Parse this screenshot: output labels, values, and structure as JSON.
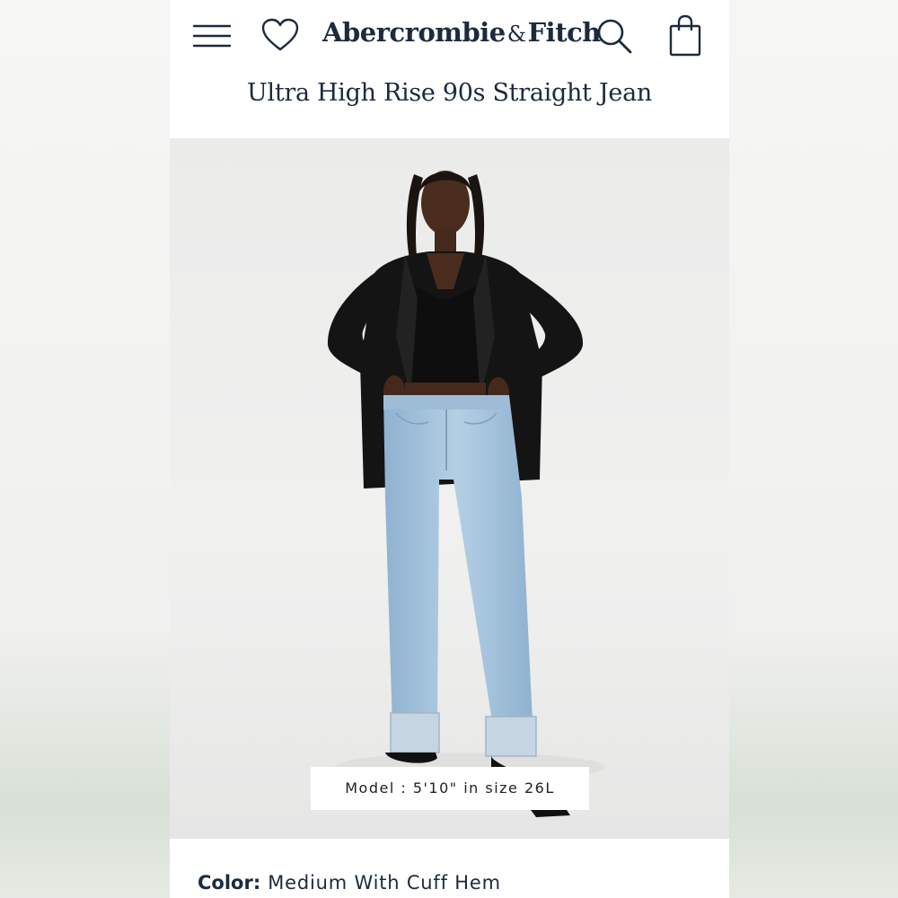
{
  "header": {
    "logo_left": "Abercrombie",
    "logo_amp": "&",
    "logo_right": "Fitch",
    "icons": [
      "menu-icon",
      "heart-icon",
      "search-icon",
      "bag-icon"
    ]
  },
  "product": {
    "title": "Ultra High Rise 90s Straight Jean",
    "model_caption": "Model : 5'10\" in size 26L",
    "color_label": "Color:",
    "color_value": "Medium With Cuff Hem"
  },
  "colors": {
    "brand_navy": "#1c2a3e",
    "denim": "#9ec0dc",
    "blazer": "#141414"
  }
}
